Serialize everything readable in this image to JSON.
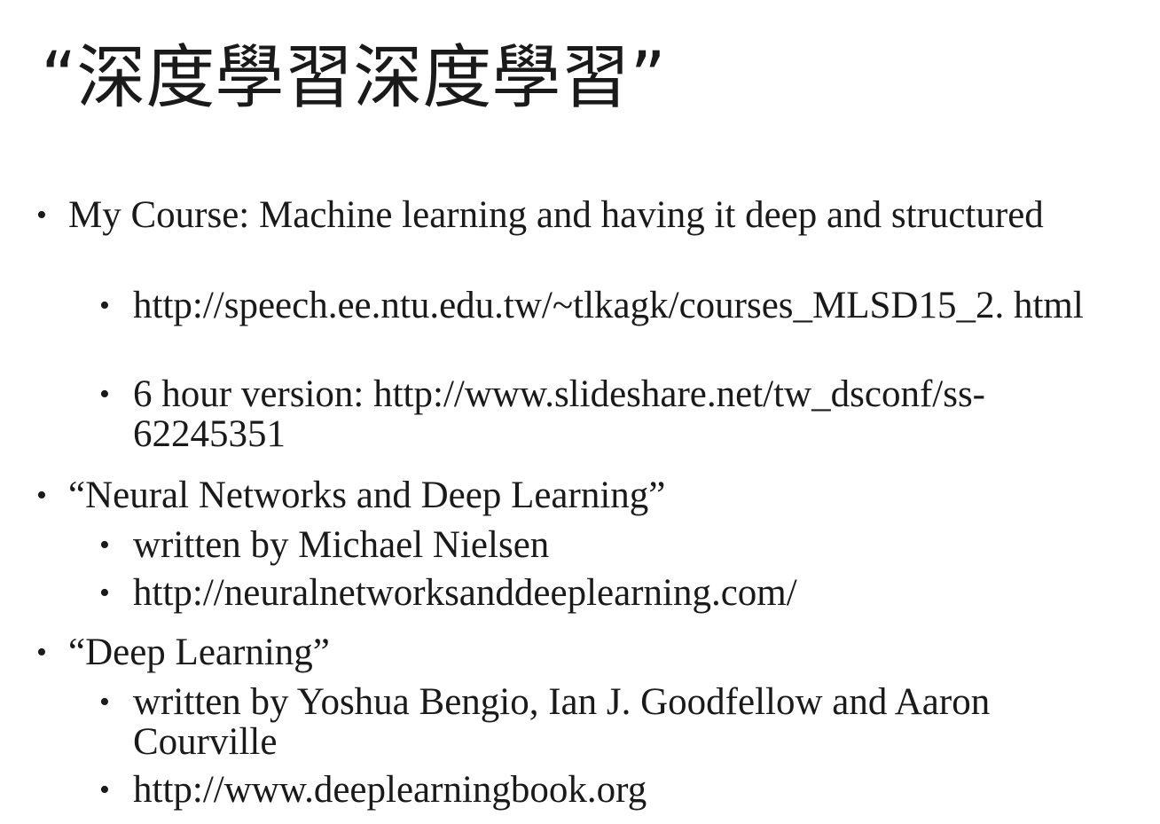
{
  "slide": {
    "title": "“深度學習深度學習”",
    "bullet_glyph": "•",
    "items": [
      {
        "text": "My Course: Machine learning and having it deep and structured"
      },
      {
        "text": "http://speech.ee.ntu.edu.tw/~tlkagk/courses_MLSD15_2. html"
      },
      {
        "text": "6 hour version: http://www.slideshare.net/tw_dsconf/ss- 62245351"
      },
      {
        "text": "“Neural Networks and Deep Learning”"
      },
      {
        "text": "written by Michael Nielsen"
      },
      {
        "text": "http://neuralnetworksanddeeplearning.com/"
      },
      {
        "text": "“Deep Learning”"
      },
      {
        "text": "written by Yoshua Bengio, Ian J. Goodfellow and Aaron Courville"
      },
      {
        "text": "http://www.deeplearningbook.org"
      }
    ]
  }
}
